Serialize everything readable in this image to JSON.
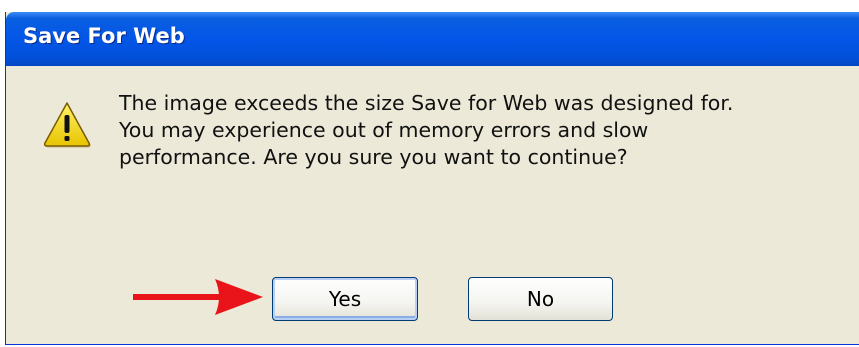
{
  "dialog": {
    "title": "Save For Web",
    "message_lines": [
      "The image exceeds the size Save for Web was designed for.",
      "You may experience out of memory errors and slow",
      "performance.  Are you sure you want to continue?"
    ],
    "icon": "warning-icon",
    "buttons": {
      "yes_label": "Yes",
      "no_label": "No"
    }
  },
  "annotation": {
    "icon": "red-arrow-icon",
    "color": "#e8141a"
  },
  "colors": {
    "titlebar": "#0356e8",
    "dialog_background": "#ece9d8",
    "warning_fill": "#f5d820"
  }
}
